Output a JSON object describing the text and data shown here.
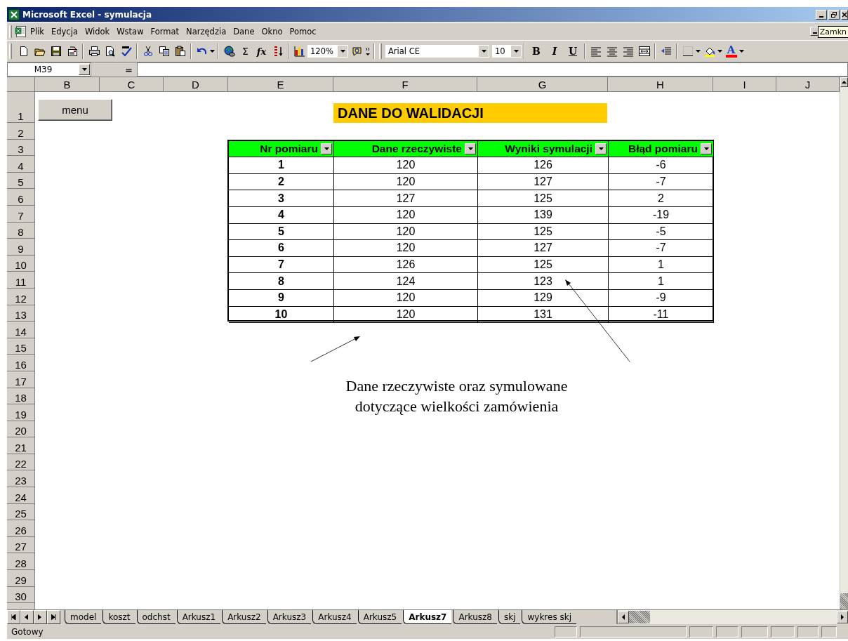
{
  "window": {
    "title": "Microsoft Excel - symulacja"
  },
  "menu": [
    "Plik",
    "Edycja",
    "Widok",
    "Wstaw",
    "Format",
    "Narzędzia",
    "Dane",
    "Okno",
    "Pomoc"
  ],
  "tooltip": "Zamkn",
  "toolbar": {
    "sum": "Σ",
    "function": "fx",
    "zoom": "120%",
    "font": "Arial CE",
    "size": "10",
    "bold": "B",
    "italic": "I",
    "underline": "U",
    "font_color": "A"
  },
  "formula_bar": {
    "name_box": "M39",
    "equals": "="
  },
  "columns": [
    "B",
    "C",
    "D",
    "E",
    "F",
    "G",
    "H",
    "I",
    "J"
  ],
  "row_numbers": [
    "1",
    "2",
    "3",
    "4",
    "5",
    "6",
    "7",
    "8",
    "9",
    "10",
    "11",
    "12",
    "13",
    "14",
    "15",
    "16",
    "17",
    "18",
    "19",
    "20",
    "21",
    "22",
    "23",
    "24",
    "25",
    "26",
    "27",
    "28",
    "29",
    "30"
  ],
  "menu_button": "menu",
  "sheet_title": "DANE DO WALIDACJI",
  "table": {
    "columns": [
      "Nr pomiaru",
      "Dane rzeczywiste",
      "Wyniki symulacji",
      "Błąd pomiaru"
    ],
    "rows": [
      [
        "1",
        "120",
        "126",
        "-6"
      ],
      [
        "2",
        "120",
        "127",
        "-7"
      ],
      [
        "3",
        "127",
        "125",
        "2"
      ],
      [
        "4",
        "120",
        "139",
        "-19"
      ],
      [
        "5",
        "120",
        "125",
        "-5"
      ],
      [
        "6",
        "120",
        "127",
        "-7"
      ],
      [
        "7",
        "126",
        "125",
        "1"
      ],
      [
        "8",
        "124",
        "123",
        "1"
      ],
      [
        "9",
        "120",
        "129",
        "-9"
      ],
      [
        "10",
        "120",
        "131",
        "-11"
      ]
    ]
  },
  "annotation": "Dane rzeczywiste oraz symulowane\ndotyczące wielkości zamówienia",
  "sheet_tabs": [
    {
      "label": "model",
      "selected": false
    },
    {
      "label": "koszt",
      "selected": false
    },
    {
      "label": "odchst",
      "selected": false
    },
    {
      "label": "Arkusz1",
      "selected": false
    },
    {
      "label": "Arkusz2",
      "selected": false
    },
    {
      "label": "Arkusz3",
      "selected": false
    },
    {
      "label": "Arkusz4",
      "selected": false
    },
    {
      "label": "Arkusz5",
      "selected": false
    },
    {
      "label": "Arkusz7",
      "selected": true
    },
    {
      "label": "Arkusz8",
      "selected": false
    },
    {
      "label": "skj",
      "selected": false
    },
    {
      "label": "wykres skj",
      "selected": false
    }
  ],
  "status_bar": {
    "text": "Gotowy"
  }
}
